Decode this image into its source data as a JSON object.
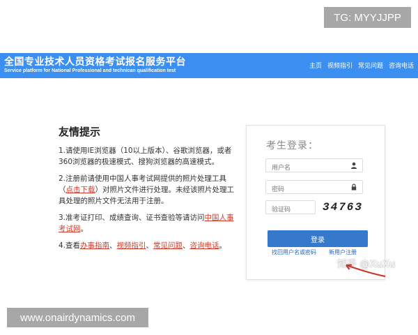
{
  "watermarks": {
    "top": "TG: MYYJJPP",
    "bottom": "www.onairdynamics.com",
    "zhihu": "知乎 @XuXu"
  },
  "header": {
    "title": "全国专业技术人员资格考试报名服务平台",
    "subtitle": "Service platform for National Professional and technican qualification test",
    "nav": [
      "主页",
      "视频指引",
      "常见问题",
      "咨询电话"
    ]
  },
  "tips": {
    "title": "友情提示",
    "item1": "1.请使用IE浏览器（10以上版本）、谷歌浏览器，或者360浏览器的极速模式、搜狗浏览器的高速模式。",
    "item2_prefix": "2.注册前请使用中国人事考试网提供的照片处理工具（",
    "item2_link": "点击下载",
    "item2_suffix": "）对照片文件进行处理。未经该照片处理工具处理的照片文件无法用于注册。",
    "item3_prefix": "3.准考证打印、成绩查询、证书查验等请访问",
    "item3_link": "中国人事考试网",
    "item3_suffix": "。",
    "item4_prefix": "4.查看",
    "item4_links": [
      "办事指南",
      "视频指引",
      "常见问题",
      "咨询电话"
    ],
    "item4_sep": "、",
    "item4_suffix": "。"
  },
  "login": {
    "title": "考生登录：",
    "username_placeholder": "用户名",
    "password_placeholder": "密码",
    "captcha_placeholder": "验证码",
    "captcha_text": "34763",
    "submit": "登录",
    "forgot": "找回用户名或密码",
    "register": "新用户注册"
  },
  "colors": {
    "header_bg": "#3b8ff0",
    "button_bg": "#3579cc",
    "link": "#d03a2a",
    "login_link": "#2a62b8"
  }
}
